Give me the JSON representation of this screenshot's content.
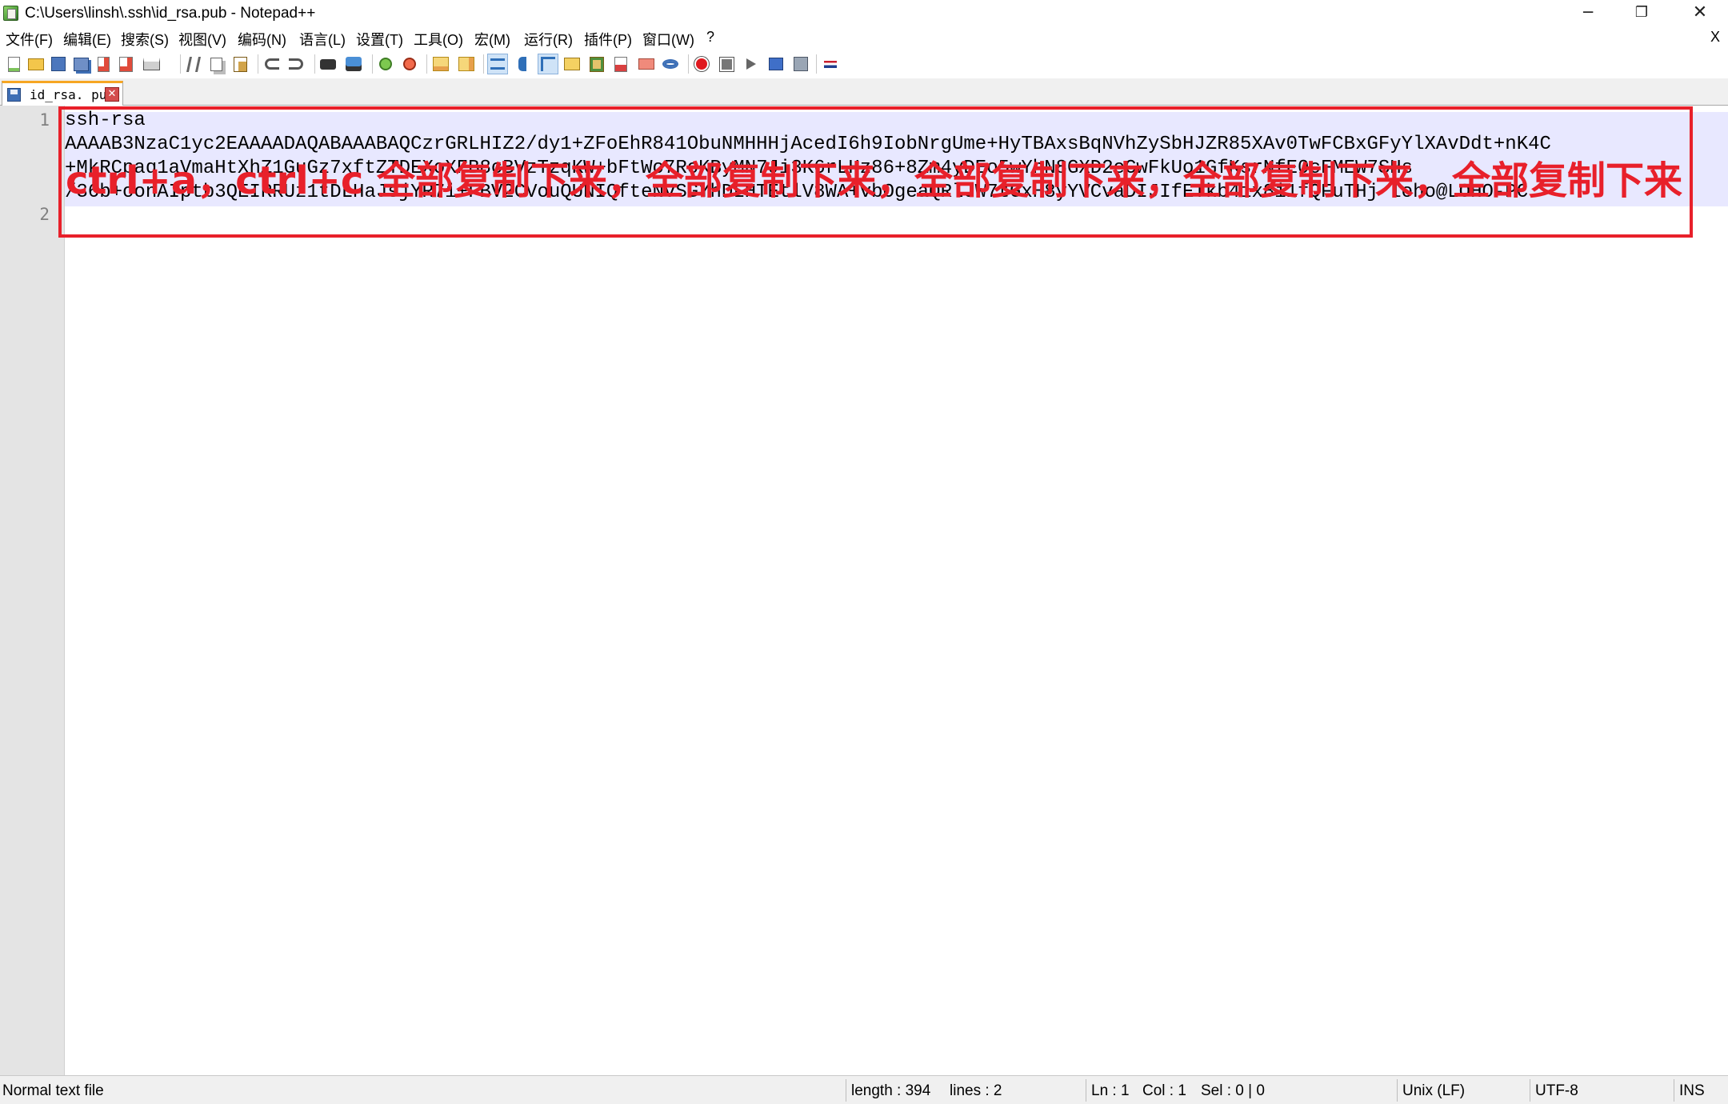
{
  "window": {
    "title": "C:\\Users\\linsh\\.ssh\\id_rsa.pub - Notepad++",
    "minimize": "─",
    "maximize": "❐",
    "close": "✕"
  },
  "menu": {
    "items": [
      "文件(F)",
      "编辑(E)",
      "搜索(S)",
      "视图(V)",
      "编码(N)",
      "语言(L)",
      "设置(T)",
      "工具(O)",
      "宏(M)",
      "运行(R)",
      "插件(P)",
      "窗口(W)",
      "?"
    ],
    "close_doc": "X"
  },
  "toolbar": {
    "icons": [
      "new-file-icon",
      "open-file-icon",
      "save-icon",
      "save-all-icon",
      "close-icon",
      "close-all-icon",
      "print-icon",
      "cut-icon",
      "copy-icon",
      "paste-icon",
      "undo-icon",
      "redo-icon",
      "find-icon",
      "replace-icon",
      "zoom-in-icon",
      "zoom-out-icon",
      "sync-vertical-icon",
      "sync-horizontal-icon",
      "word-wrap-icon",
      "show-all-chars-icon",
      "indent-guide-icon",
      "user-define-lang-icon",
      "doc-map-icon",
      "function-list-icon",
      "folder-workspace-icon",
      "monitoring-icon",
      "record-macro-icon",
      "stop-record-icon",
      "play-macro-icon",
      "run-macro-multiple-icon",
      "save-macro-icon",
      "language-flag-icon"
    ]
  },
  "tab": {
    "label": "id_rsa. pub",
    "close": "✕"
  },
  "editor": {
    "line_numbers": [
      "1",
      "2"
    ],
    "lines": [
      "ssh-rsa",
      "AAAAB3NzaC1yc2EAAAADAQABAAABAQCzrGRLHIZ2/dy1+ZFoEhR841ObuNMHHHjAcedI6h9IobNrgUme+HyTBAxsBqNVhZySbHJZR85XAv0TwFCBxGFyYlXAvDdt+nK4C",
      "+MkRCpaq1aVmaHtXhZ1GuGz7xftZTDEXoXFB8cBVzTzqKW+bFtWo7RoKByMN7Ji3K6rLHz86+8Zm4yDEo5wYhN8GXD2eCwFkUo1GfKsrNfE0cFMEW7SHs",
      "/36b+oonAIptb3QEIRRUz1tDLHaJsjYR7i+FBV2CVouQUNIQfteNvSGYhDLHTEtlV8WA+vbOgeaQRlJW7tGxH8yYVCvaDIJIfETkb4ix8i1fQFuTHj loho@LOHO-PC"
    ],
    "annotation": "ctrl+a，ctrl+c  全部复制下来，全部复制下来，全部复制下来，全部复制下来，全部复制下来"
  },
  "status": {
    "file_type": "Normal text file",
    "length": "length : 394",
    "lines": "lines : 2",
    "ln": "Ln : 1",
    "col": "Col : 1",
    "sel": "Sel : 0 | 0",
    "eol": "Unix (LF)",
    "encoding": "UTF-8",
    "mode": "INS"
  },
  "colors": {
    "annotation_red": "#e8202a",
    "selection_bg": "#e8e8ff",
    "gutter_bg": "#e4e4e4",
    "tab_accent": "#f6a623"
  }
}
